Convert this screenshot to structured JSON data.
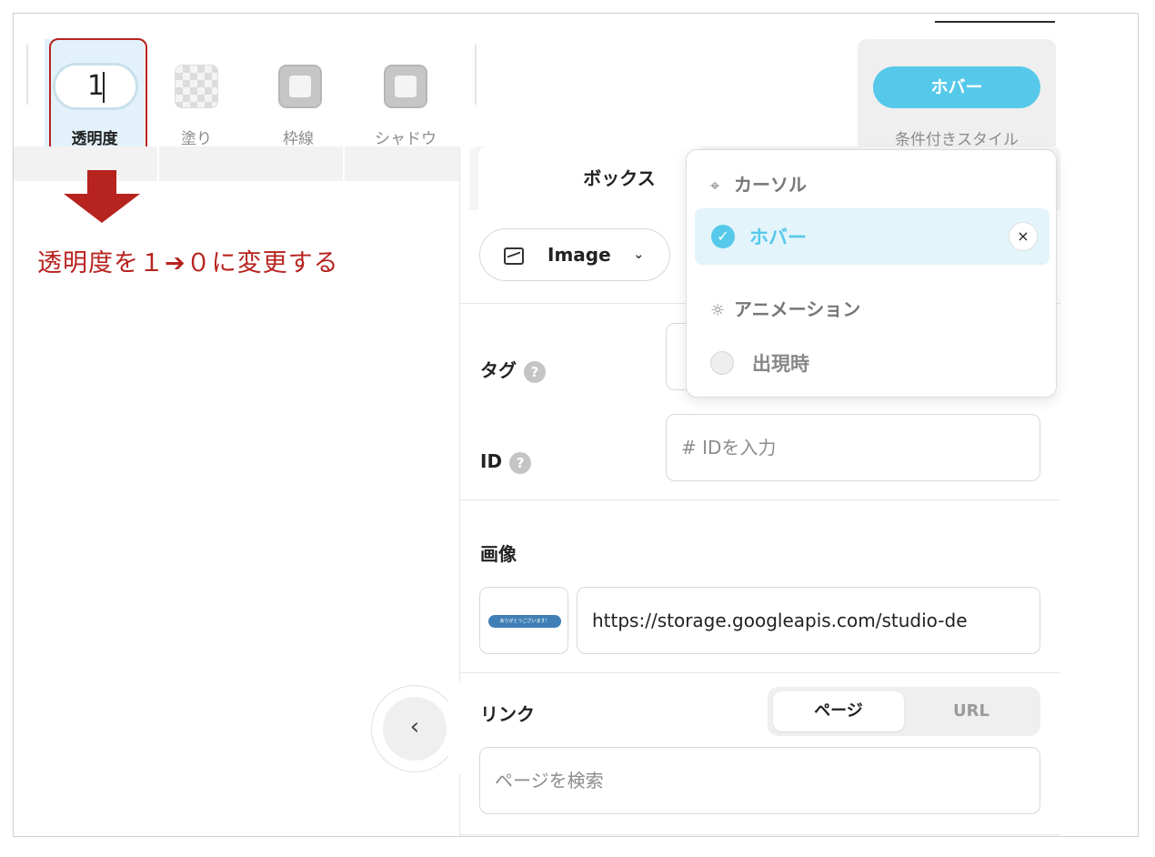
{
  "toolbar": {
    "opacity": {
      "value": "1",
      "label": "透明度"
    },
    "fill": {
      "label": "塗り",
      "icon": "checkerboard-icon"
    },
    "border": {
      "label": "枠線",
      "icon": "square-icon"
    },
    "shadow": {
      "label": "シャドウ",
      "icon": "square-icon"
    },
    "conditional": {
      "button_label": "ホバー",
      "label": "条件付きスタイル"
    }
  },
  "annotation": {
    "text": "透明度を１➔０に変更する",
    "color": "#b7231f"
  },
  "panel": {
    "tab_label": "ボックス",
    "element_type": "Image",
    "tag": {
      "label": "タグ",
      "help": "?"
    },
    "id": {
      "label": "ID",
      "help": "?",
      "placeholder": "# IDを入力"
    },
    "image": {
      "label": "画像",
      "url": "https://storage.googleapis.com/studio-de",
      "thumb_text": "ありがとうございます！"
    },
    "link": {
      "label": "リンク",
      "mode_page": "ページ",
      "mode_url": "URL",
      "search_placeholder": "ページを検索"
    },
    "collapse_icon": "chevron-left-icon"
  },
  "dropdown": {
    "cursor_section": "カーソル",
    "hover_option": "ホバー",
    "close": "×",
    "animation_section": "アニメーション",
    "appear_option": "出現時"
  },
  "colors": {
    "accent": "#56c9ea",
    "active_tool_bg": "#e3f2fa",
    "annotation": "#b7231f"
  }
}
